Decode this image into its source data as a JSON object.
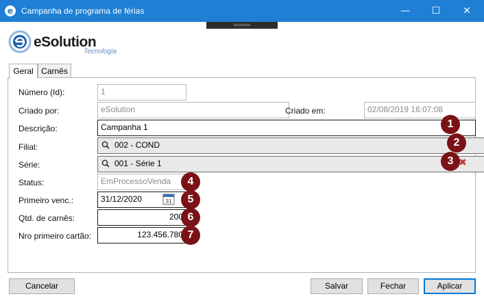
{
  "window": {
    "title": "Campanha de programa de férias",
    "icon": "e-icon",
    "minimize_glyph": "—",
    "maximize_glyph": "☐",
    "close_glyph": "✕"
  },
  "logo": {
    "brand": "eSolution",
    "tagline": "Tecnologia",
    "mark": "e"
  },
  "tabs": [
    {
      "label": "Geral",
      "active": true
    },
    {
      "label": "Carnês",
      "active": false
    }
  ],
  "form": {
    "numero_label": "Número (Id):",
    "numero_value": "1",
    "criado_por_label": "Criado por:",
    "criado_por_value": "eSolution",
    "criado_em_label": "Criado em:",
    "criado_em_value": "02/08/2019 16:07:08",
    "descricao_label": "Descrição:",
    "descricao_value": "Campanha 1",
    "filial_label": "Filial:",
    "filial_value": "002 - COND",
    "serie_label": "Série:",
    "serie_value": "001 - Série 1",
    "status_label": "Status:",
    "status_value": "EmProcessoVenda",
    "primeiro_venc_label": "Primeiro venc.:",
    "primeiro_venc_value": "31/12/2020",
    "calendar_day": "31",
    "qtd_carnes_label": "Qtd. de carnês:",
    "qtd_carnes_value": "200",
    "nro_cartao_label": "Nro primeiro cartão:",
    "nro_cartao_value": "123.456.780"
  },
  "badges": [
    "1",
    "2",
    "3",
    "4",
    "5",
    "6",
    "7"
  ],
  "badge_color": "#7a1216",
  "buttons": {
    "cancelar": "Cancelar",
    "salvar": "Salvar",
    "fechar": "Fechar",
    "aplicar": "Aplicar"
  }
}
